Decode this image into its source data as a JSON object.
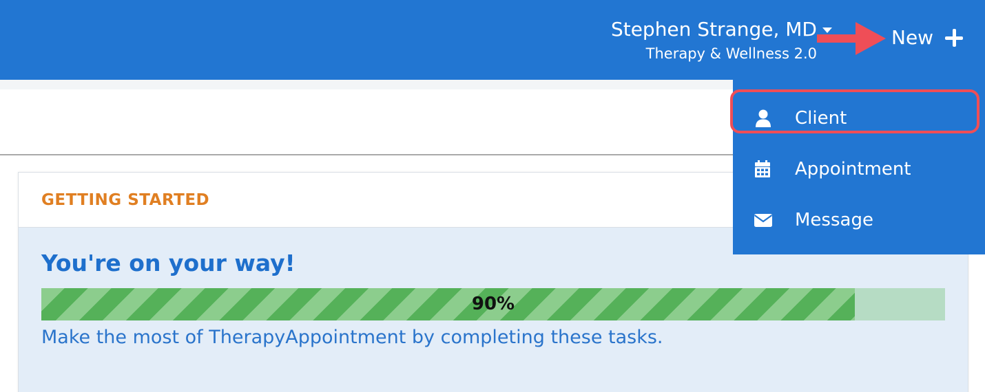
{
  "header": {
    "user_name": "Stephen Strange, MD",
    "practice_name": "Therapy & Wellness 2.0",
    "new_label": "New"
  },
  "menu": {
    "items": [
      {
        "label": "Client",
        "icon": "user-icon",
        "highlighted": true
      },
      {
        "label": "Appointment",
        "icon": "calendar-icon",
        "highlighted": false
      },
      {
        "label": "Message",
        "icon": "envelope-icon",
        "highlighted": false
      }
    ]
  },
  "card": {
    "title": "GETTING STARTED",
    "headline": "You're on your way!",
    "progress_value": 0.9,
    "progress_label": "90%",
    "link_text": "Make the most of TherapyAppointment by completing these tasks."
  },
  "colors": {
    "brand_blue": "#2276d2",
    "accent_orange": "#e07f22",
    "progress_green": "#58b45c",
    "annotation_red": "#ef4e57"
  }
}
